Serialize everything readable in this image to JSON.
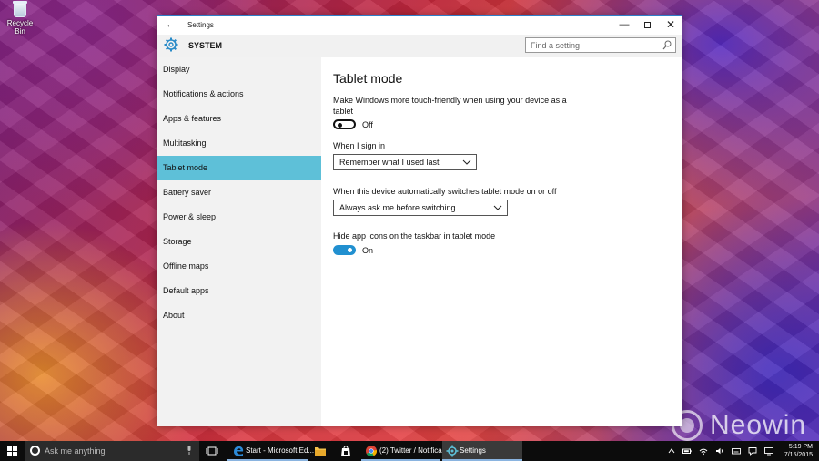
{
  "desktop": {
    "recycle_bin_label": "Recycle Bin",
    "watermark": "Neowin"
  },
  "window": {
    "title": "Settings",
    "back_glyph": "←",
    "controls": {
      "minimize": "—",
      "close": "✕"
    }
  },
  "header": {
    "section": "SYSTEM",
    "search_placeholder": "Find a setting"
  },
  "sidebar": {
    "items": [
      {
        "label": "Display"
      },
      {
        "label": "Notifications & actions"
      },
      {
        "label": "Apps & features"
      },
      {
        "label": "Multitasking"
      },
      {
        "label": "Tablet mode",
        "active": true
      },
      {
        "label": "Battery saver"
      },
      {
        "label": "Power & sleep"
      },
      {
        "label": "Storage"
      },
      {
        "label": "Offline maps"
      },
      {
        "label": "Default apps"
      },
      {
        "label": "About"
      }
    ]
  },
  "content": {
    "title": "Tablet mode",
    "touch_friendly": {
      "description_line1": "Make Windows more touch-friendly when using your device as a",
      "description_line2": "tablet",
      "state_label": "Off"
    },
    "sign_in": {
      "label": "When I sign in",
      "selected": "Remember what I used last"
    },
    "auto_switch": {
      "label": "When this device automatically switches tablet mode on or off",
      "selected": "Always ask me before switching"
    },
    "hide_icons": {
      "label": "Hide app icons on the taskbar in tablet mode",
      "state_label": "On"
    }
  },
  "taskbar": {
    "search_placeholder": "Ask me anything",
    "tasks": [
      {
        "label": "Start - Microsoft Ed..."
      },
      {
        "label": "(2) Twitter / Notifica..."
      },
      {
        "label": "Settings"
      }
    ],
    "clock": {
      "time": "5:19 PM",
      "date": "7/15/2015"
    }
  },
  "colors": {
    "accent": "#5ec0d8",
    "toggle_on": "#2190d0",
    "window_border": "#2f7fc9",
    "taskbar": "#0c0c0c"
  }
}
